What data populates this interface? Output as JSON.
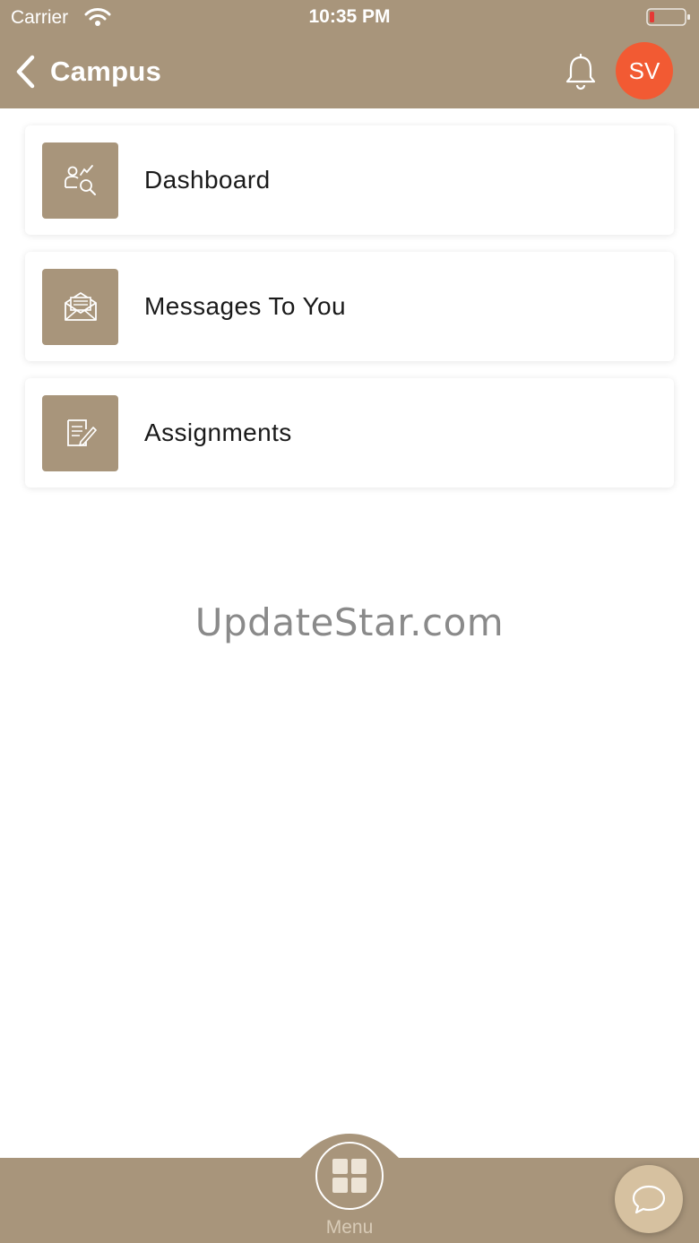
{
  "status_bar": {
    "carrier": "Carrier",
    "time": "10:35 PM",
    "wifi_icon": "wifi-icon",
    "battery_icon": "battery-low-icon"
  },
  "nav": {
    "back_icon": "chevron-left-icon",
    "title": "Campus",
    "notification_icon": "bell-icon",
    "avatar_initials": "SV"
  },
  "menu_items": [
    {
      "label": "Dashboard",
      "icon": "user-search-icon"
    },
    {
      "label": "Messages To You",
      "icon": "envelope-open-icon"
    },
    {
      "label": "Assignments",
      "icon": "document-edit-icon"
    }
  ],
  "watermark": "UpdateStar.com",
  "tab_bar": {
    "menu_label": "Menu",
    "menu_icon": "grid-icon",
    "chat_icon": "chat-bubble-icon"
  },
  "colors": {
    "primary": "#a8957b",
    "avatar": "#f25a33",
    "chat_button": "#d6c1a0",
    "battery_low": "#e53935"
  }
}
